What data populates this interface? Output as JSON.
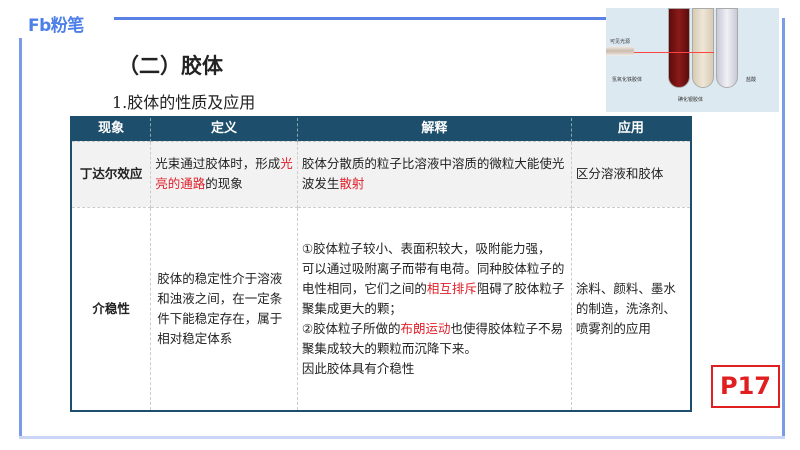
{
  "logo": "Fb粉笔",
  "title": "（二）胶体",
  "subtitle": "1.胶体的性质及应用",
  "image_labels": {
    "light": "可见光源",
    "fe": "氢氧化铁胶体",
    "agi": "碘化银胶体",
    "hcl": "盐酸"
  },
  "table": {
    "headers": [
      "现象",
      "定义",
      "解释",
      "应用"
    ],
    "row1": {
      "name": "丁达尔效应",
      "def_a": "光束通过胶体时，形成",
      "def_red": "光亮的通路",
      "def_b": "的现象",
      "exp_a": "胶体分散质的粒子比溶液中溶质的微粒大能使光波发生",
      "exp_red": "散射",
      "app": "区分溶液和胶体"
    },
    "row2": {
      "name": "介稳性",
      "def": "胶体的稳定性介于溶液和浊液之间，在一定条件下能稳定存在，属于相对稳定体系",
      "exp_a": "①胶体粒子较小、表面积较大，吸附能力强， 可以通过吸附离子而带有电荷。同种胶体粒子的电性相同，它们之间的",
      "exp_red1": "相互排斥",
      "exp_b": "阻碍了胶体粒子聚集成更大的颗；",
      "exp_c": "②胶体粒子所做的",
      "exp_red2": "布朗运动",
      "exp_d": "也使得胶体粒子不易聚集成较大的颗粒而沉降下来。",
      "exp_e": "因此胶体具有介稳性",
      "app": "涂料、颜料、墨水的制造，洗涤剂、喷雾剂的应用"
    }
  },
  "page_badge": "P17"
}
